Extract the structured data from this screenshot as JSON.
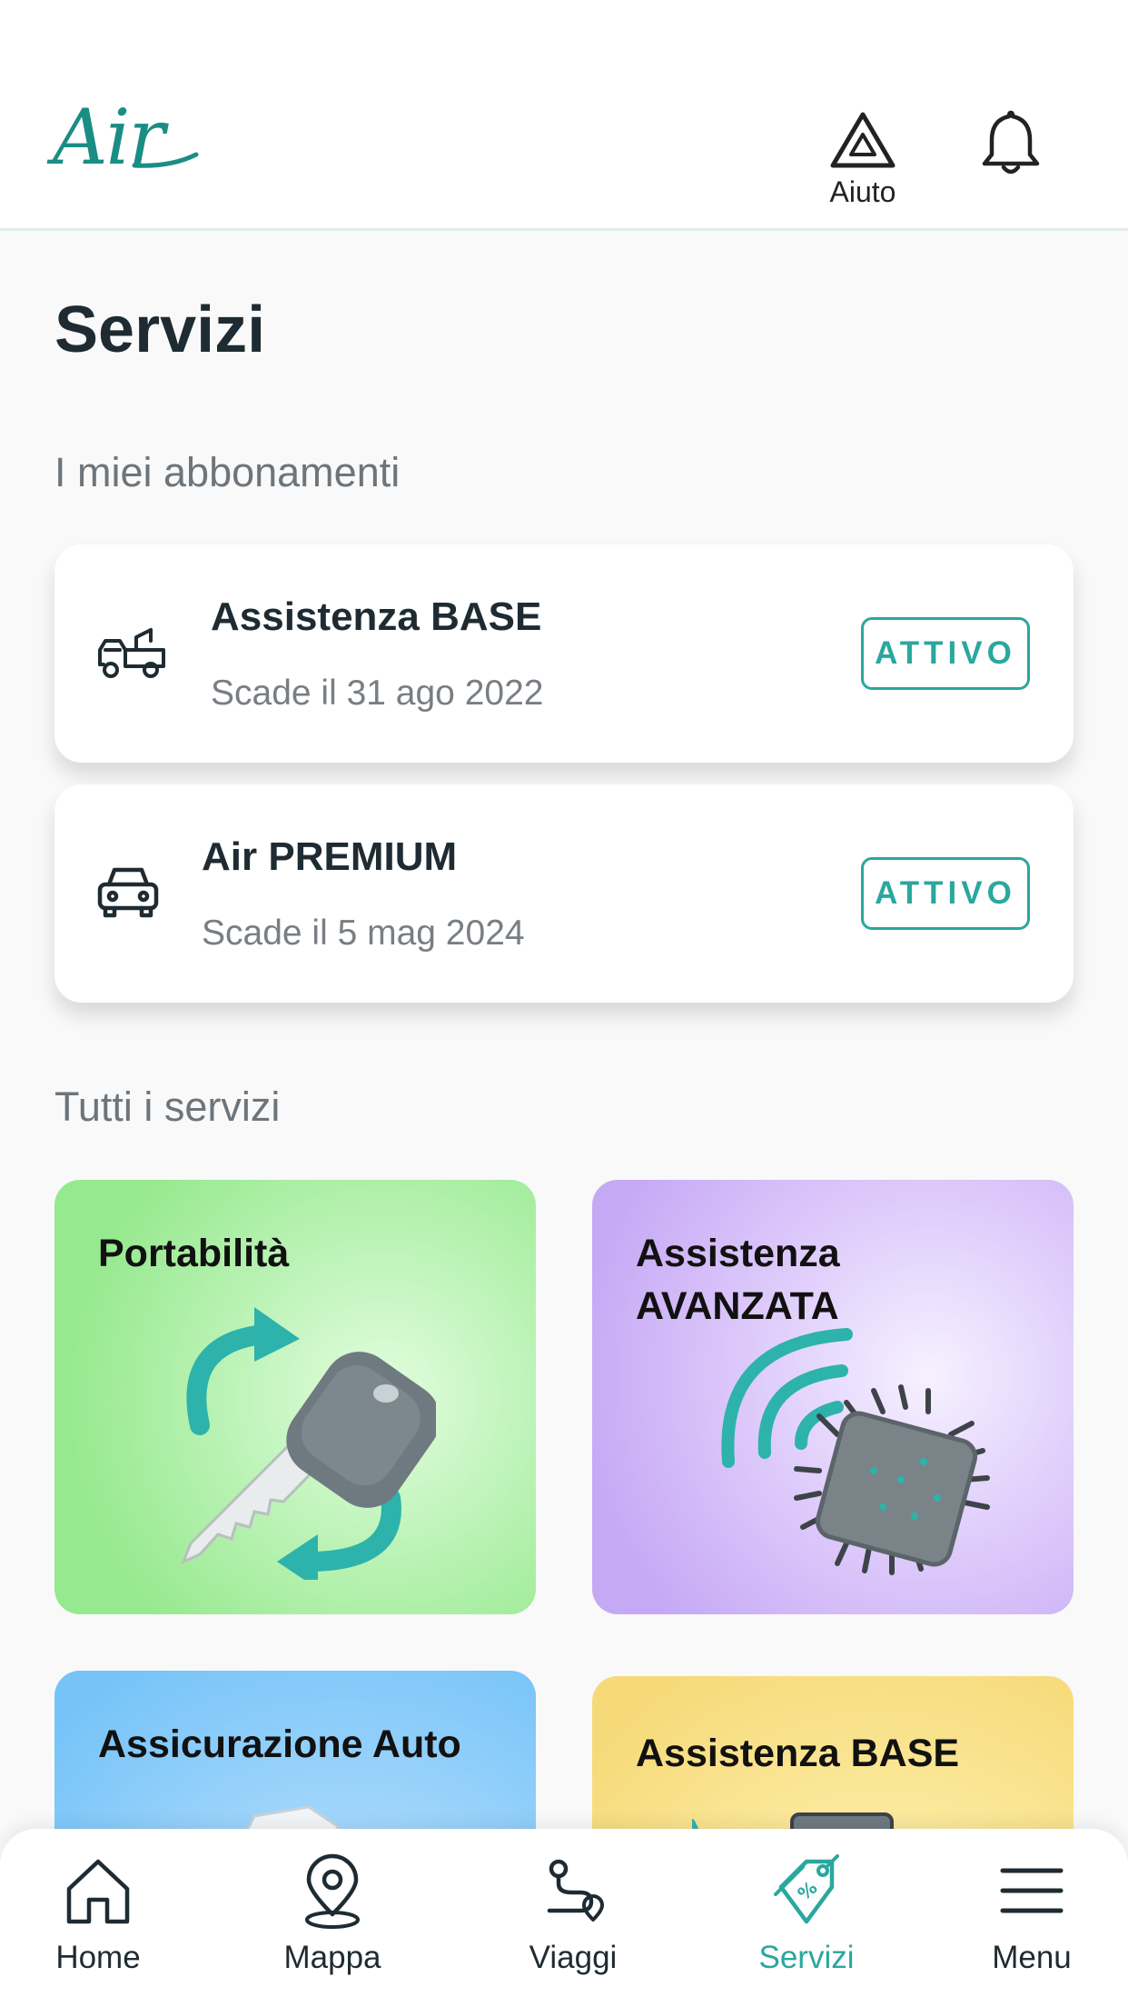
{
  "header": {
    "logo_text": "Air",
    "help_label": "Aiuto",
    "help_icon": "triangle-warning-icon",
    "notification_icon": "bell-icon"
  },
  "page_title": "Servizi",
  "subscriptions": {
    "section_label": "I miei abbonamenti",
    "items": [
      {
        "name": "Assistenza BASE",
        "expiry": "Scade il 31 ago 2022",
        "status": "ATTIVO",
        "icon": "tow-truck-icon"
      },
      {
        "name": "Air PREMIUM",
        "expiry": "Scade il 5 mag 2024",
        "status": "ATTIVO",
        "icon": "car-icon"
      }
    ]
  },
  "services": {
    "section_label": "Tutti i servizi",
    "tiles": [
      {
        "title": "Portabilità",
        "color": "#97e98f",
        "icon": "key-transfer-icon"
      },
      {
        "title": "Assistenza AVANZATA",
        "color": "#c6a9f5",
        "icon": "chip-signal-icon"
      },
      {
        "title": "Assicurazione Auto",
        "color": "#76c3f8",
        "icon": "insurance-document-icon"
      },
      {
        "title": "Assistenza BASE",
        "color": "#f6d978",
        "icon": "assistance-device-icon"
      }
    ]
  },
  "bottom_nav": {
    "active": "Servizi",
    "accent_color": "#2aa79e",
    "items": [
      {
        "label": "Home",
        "icon": "home-icon"
      },
      {
        "label": "Mappa",
        "icon": "map-pin-icon"
      },
      {
        "label": "Viaggi",
        "icon": "route-icon"
      },
      {
        "label": "Servizi",
        "icon": "discount-tag-icon"
      },
      {
        "label": "Menu",
        "icon": "hamburger-menu-icon"
      }
    ]
  }
}
